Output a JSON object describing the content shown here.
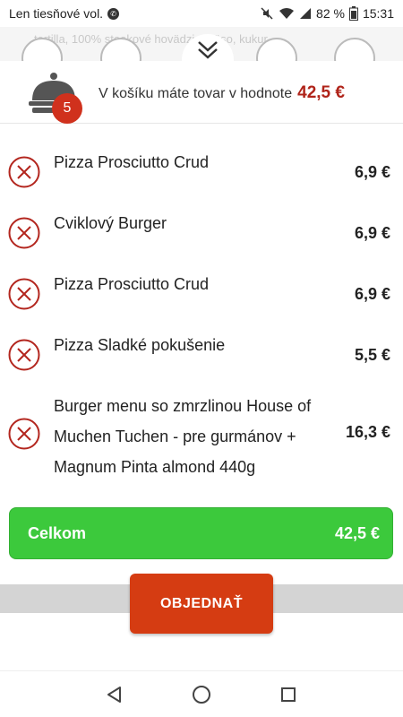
{
  "status_bar": {
    "carrier": "Len tiesňové vol.",
    "battery": "82 %",
    "time": "15:31"
  },
  "background": {
    "text": "tortilla, 100% steakové hovädzie mäso, kukur..."
  },
  "cart": {
    "badge_count": "5",
    "header_text": "V košíku máte tovar v hodnote",
    "header_total": "42,5 €",
    "items": [
      {
        "name": "Pizza Prosciutto Crud",
        "price": "6,9 €"
      },
      {
        "name": "Cviklový Burger",
        "price": "6,9 €"
      },
      {
        "name": "Pizza Prosciutto Crud",
        "price": "6,9 €"
      },
      {
        "name": "Pizza Sladké pokušenie",
        "price": "5,5 €"
      },
      {
        "name": "Burger menu so zmrzlinou House of Muchen Tuchen - pre gurmánov + Magnum Pinta almond 440g",
        "price": "16,3 €"
      }
    ],
    "total_label": "Celkom",
    "total_value": "42,5 €",
    "order_label": "OBJEDNAŤ"
  },
  "colors": {
    "accent_red": "#d0311d",
    "total_green": "#3cc93c",
    "order_orange": "#d53c12"
  }
}
